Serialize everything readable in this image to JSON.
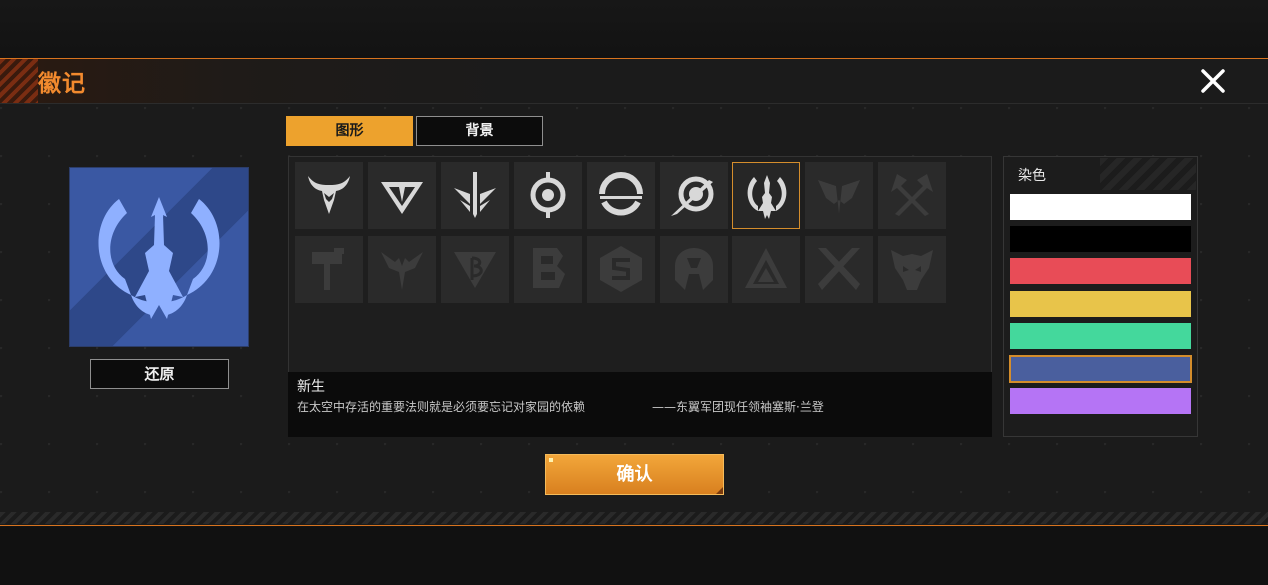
{
  "dialog": {
    "title": "徽记",
    "close_icon": "close-icon"
  },
  "preview": {
    "emblem": "xinsheng-emblem",
    "emblem_color": "#8fb0ff",
    "background_colors": [
      "#3a58a3",
      "#2e4889"
    ],
    "reset_label": "还原"
  },
  "tabs": [
    {
      "label": "图形",
      "active": true
    },
    {
      "label": "背景",
      "active": false
    }
  ],
  "emblem_grid": {
    "rows": [
      [
        {
          "icon": "horned-skull-emblem-icon",
          "locked": false
        },
        {
          "icon": "diamond-shield-emblem-icon",
          "locked": false
        },
        {
          "icon": "winged-blade-emblem-icon",
          "locked": false
        },
        {
          "icon": "target-eye-emblem-icon",
          "locked": false
        },
        {
          "icon": "split-circle-emblem-icon",
          "locked": false
        },
        {
          "icon": "comet-ring-emblem-icon",
          "locked": false
        },
        {
          "icon": "xinsheng-trident-emblem-icon",
          "locked": false,
          "selected": true
        },
        {
          "icon": "mantis-head-emblem-icon",
          "locked": true
        },
        {
          "icon": "crossed-axes-emblem-icon",
          "locked": true
        }
      ],
      [
        {
          "icon": "hammer-emblem-icon",
          "locked": true
        },
        {
          "icon": "bat-dagger-emblem-icon",
          "locked": true
        },
        {
          "icon": "beta-triangle-emblem-icon",
          "locked": true
        },
        {
          "icon": "letter-b-emblem-icon",
          "locked": true
        },
        {
          "icon": "s-hexagon-emblem-icon",
          "locked": true
        },
        {
          "icon": "helmet-emblem-icon",
          "locked": true
        },
        {
          "icon": "stacked-triangle-emblem-icon",
          "locked": true
        },
        {
          "icon": "crossed-swords-emblem-icon",
          "locked": true
        },
        {
          "icon": "beast-mask-emblem-icon",
          "locked": true
        }
      ]
    ]
  },
  "description": {
    "name": "新生",
    "text": "在太空中存活的重要法则就是必须要忘记对家园的依赖",
    "author": "——东翼军团现任领袖塞斯·兰登"
  },
  "dye": {
    "title": "染色",
    "colors": [
      {
        "hex": "#ffffff",
        "selected": false
      },
      {
        "hex": "#000000",
        "selected": false
      },
      {
        "hex": "#e84c57",
        "selected": false
      },
      {
        "hex": "#e8c44a",
        "selected": false
      },
      {
        "hex": "#44d89c",
        "selected": false
      },
      {
        "hex": "#4a5f9e",
        "selected": true
      },
      {
        "hex": "#b574f5",
        "selected": false
      }
    ]
  },
  "confirm_label": "确认",
  "colors": {
    "accent_orange": "#f28a2e",
    "tab_active": "#eda22d",
    "selected_border": "#d48d2c"
  }
}
